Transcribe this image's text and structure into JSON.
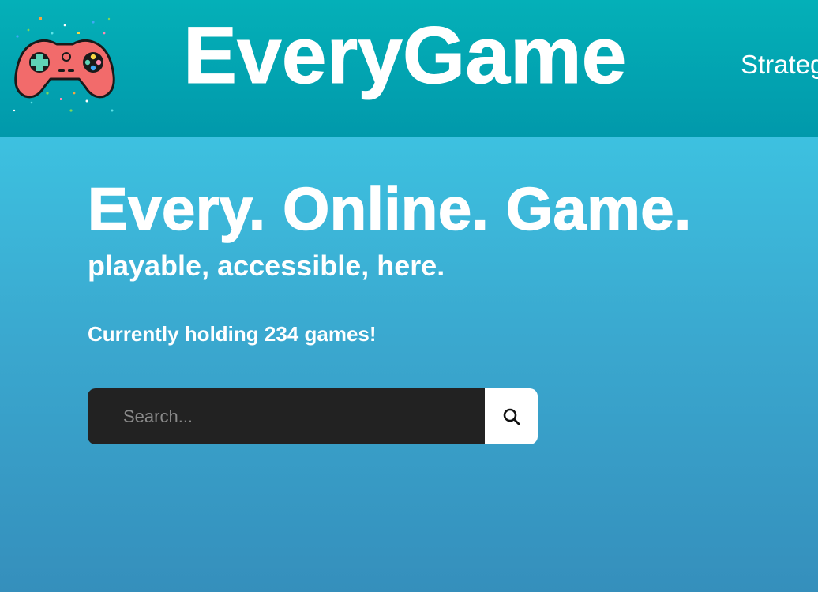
{
  "header": {
    "brand": "EveryGame",
    "nav": [
      {
        "label": "Strateg"
      }
    ],
    "logo_icon": "gamepad-icon"
  },
  "hero": {
    "title": "Every. Online. Game.",
    "subtitle": "playable, accessible, here.",
    "count_text": "Currently holding 234 games!"
  },
  "search": {
    "placeholder": "Search...",
    "value": "",
    "button_icon": "search-icon"
  },
  "colors": {
    "header_bg": "#04b0b8",
    "body_bg_top": "#3dc1e0",
    "body_bg_bottom": "#358fbc",
    "search_bg": "#222222",
    "controller": "#f26b6b",
    "text": "#ffffff"
  }
}
